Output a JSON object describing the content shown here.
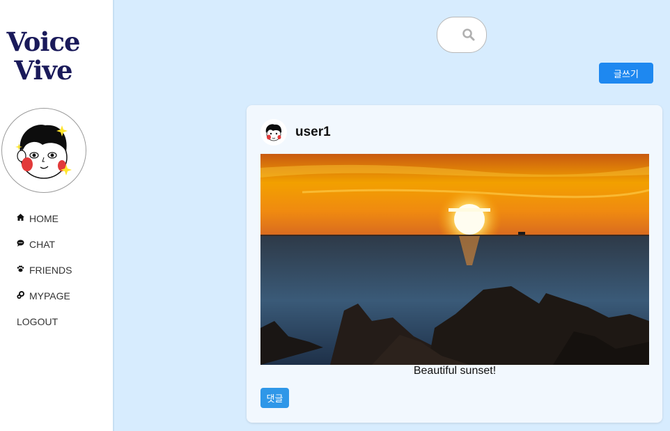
{
  "sidebar": {
    "logo_line1": "Voice",
    "logo_line2": "Vive",
    "avatar_icon": "cartoon-face-avatar",
    "nav": [
      {
        "label": "HOME",
        "icon": "home-icon"
      },
      {
        "label": "CHAT",
        "icon": "chat-bubble-icon"
      },
      {
        "label": "FRIENDS",
        "icon": "paw-icon"
      },
      {
        "label": "MYPAGE",
        "icon": "gear-icon"
      },
      {
        "label": "LOGOUT",
        "icon": ""
      }
    ]
  },
  "header": {
    "search_icon": "search-icon",
    "write_label": "글쓰기"
  },
  "post": {
    "username": "user1",
    "image_subject": "sunset-over-sea-photo",
    "caption": "Beautiful sunset!",
    "comment_label": "댓글"
  },
  "colors": {
    "background": "#d7ecfe",
    "sidebar": "#ffffff",
    "accent": "#1e88f0",
    "card": "#f2f8fe",
    "logo": "#1a1a5a"
  }
}
